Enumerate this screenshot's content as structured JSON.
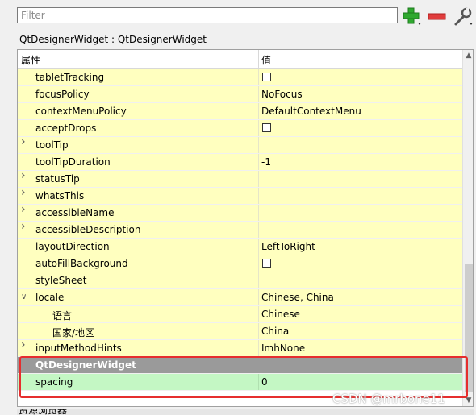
{
  "toolbar": {
    "filter_placeholder": "Filter",
    "add_icon": "plus-icon",
    "remove_icon": "minus-icon",
    "tool_icon": "wrench-icon",
    "colors": {
      "add": "#2fa82f",
      "remove": "#e03c3c"
    }
  },
  "object_title": "QtDesignerWidget : QtDesignerWidget",
  "table": {
    "col_property": "属性",
    "col_value": "值",
    "rows": [
      {
        "name": "tabletTracking",
        "value": "",
        "checkbox": true,
        "expandable": false
      },
      {
        "name": "focusPolicy",
        "value": "NoFocus",
        "checkbox": false,
        "expandable": false
      },
      {
        "name": "contextMenuPolicy",
        "value": "DefaultContextMenu",
        "checkbox": false,
        "expandable": false
      },
      {
        "name": "acceptDrops",
        "value": "",
        "checkbox": true,
        "expandable": false
      },
      {
        "name": "toolTip",
        "value": "",
        "checkbox": false,
        "expandable": true
      },
      {
        "name": "toolTipDuration",
        "value": "-1",
        "checkbox": false,
        "expandable": false
      },
      {
        "name": "statusTip",
        "value": "",
        "checkbox": false,
        "expandable": true
      },
      {
        "name": "whatsThis",
        "value": "",
        "checkbox": false,
        "expandable": true
      },
      {
        "name": "accessibleName",
        "value": "",
        "checkbox": false,
        "expandable": true
      },
      {
        "name": "accessibleDescription",
        "value": "",
        "checkbox": false,
        "expandable": true
      },
      {
        "name": "layoutDirection",
        "value": "LeftToRight",
        "checkbox": false,
        "expandable": false
      },
      {
        "name": "autoFillBackground",
        "value": "",
        "checkbox": true,
        "expandable": false
      },
      {
        "name": "styleSheet",
        "value": "",
        "checkbox": false,
        "expandable": false
      },
      {
        "name": "locale",
        "value": "Chinese, China",
        "checkbox": false,
        "expandable": true,
        "expanded": true
      },
      {
        "name": "语言",
        "value": "Chinese",
        "checkbox": false,
        "expandable": false,
        "child": true
      },
      {
        "name": "国家/地区",
        "value": "China",
        "checkbox": false,
        "expandable": false,
        "child": true
      },
      {
        "name": "inputMethodHints",
        "value": "ImhNone",
        "checkbox": false,
        "expandable": true
      }
    ],
    "section": {
      "name": "QtDesignerWidget"
    },
    "custom_row": {
      "name": "spacing",
      "value": "0"
    },
    "colors": {
      "row": "#ffffbf",
      "section": "#9a9a9a",
      "custom": "#c4f7c4",
      "highlight": "#e62e2e"
    }
  },
  "bottom_panel_label": "资源浏览器",
  "watermark": "CSDN @mrbone11"
}
